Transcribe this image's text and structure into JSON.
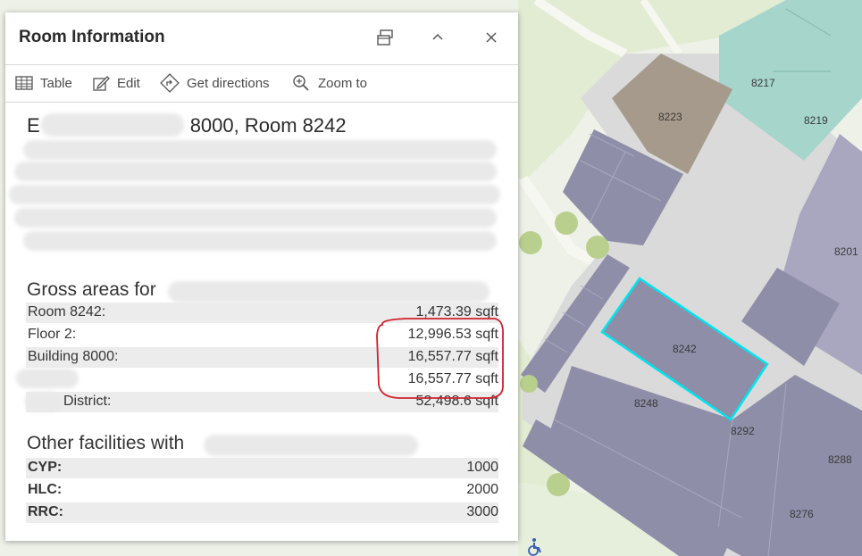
{
  "popup": {
    "title": "Room Information",
    "header_buttons": {
      "dock": "dock-icon",
      "collapse": "chevron-up-icon",
      "close": "close-icon"
    },
    "toolbar": [
      {
        "label": "Table",
        "icon": "table-icon"
      },
      {
        "label": "Edit",
        "icon": "edit-icon"
      },
      {
        "label": "Get directions",
        "icon": "directions-icon"
      },
      {
        "label": "Zoom to",
        "icon": "zoom-to-icon"
      }
    ],
    "heading_prefix": "E",
    "heading_suffix": "8000, Room 8242",
    "gross_title_prefix": "Gross areas for",
    "gross_rows": [
      {
        "label": "Room 8242:",
        "value": "1,473.39 sqft"
      },
      {
        "label": "Floor 2:",
        "value": "12,996.53 sqft"
      },
      {
        "label": "Building 8000:",
        "value": "16,557.77 sqft"
      },
      {
        "label": "",
        "value": "16,557.77 sqft"
      },
      {
        "label": "District:",
        "value": "52,498.6 sqft"
      }
    ],
    "facilities_title_prefix": "Other facilities with",
    "facility_rows": [
      {
        "label": "CYP:",
        "value": "1000"
      },
      {
        "label": "HLC:",
        "value": "2000"
      },
      {
        "label": "RRC:",
        "value": "3000"
      }
    ],
    "annotation_color": "#d0212b"
  },
  "map": {
    "room_labels": [
      "8217",
      "8219",
      "8223",
      "8201",
      "8242",
      "8248",
      "8292",
      "8288",
      "8276"
    ],
    "selected_room": "8242",
    "highlight_color": "#00e5ee",
    "room_color": "#8e8ea8",
    "tan_room_color": "#a69a8c",
    "teal_room_color": "#a6d5cc",
    "accessibility_icon": "wheelchair-icon"
  }
}
